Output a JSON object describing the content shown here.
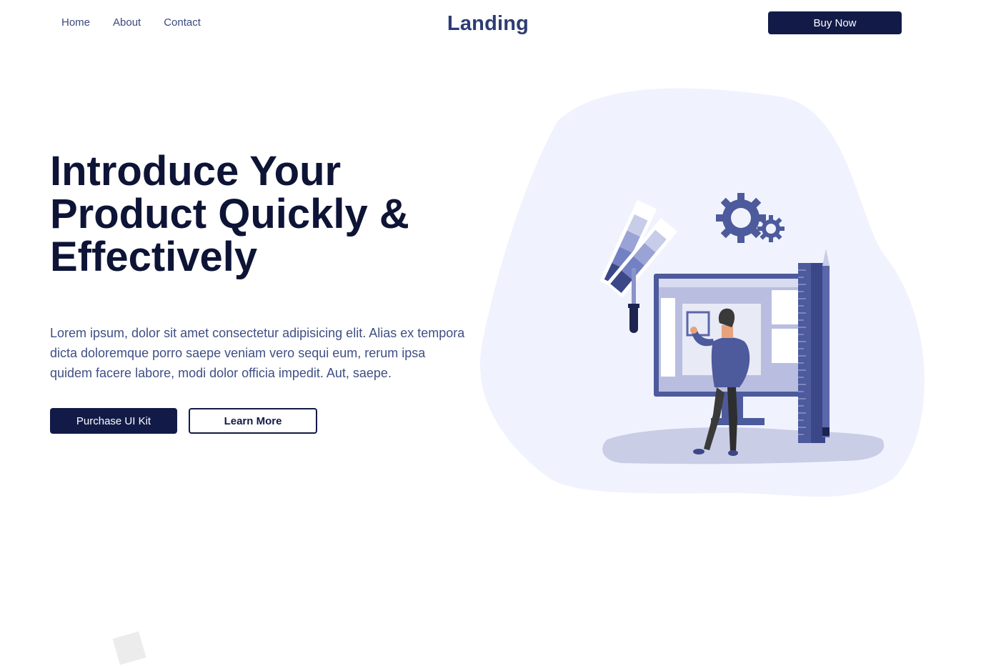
{
  "nav": {
    "links": [
      "Home",
      "About",
      "Contact"
    ],
    "brand": "Landing",
    "buy_label": "Buy Now"
  },
  "hero": {
    "title_lines": [
      "Introduce Your",
      "Product Quickly &",
      "Effectively"
    ],
    "description": "Lorem ipsum, dolor sit amet consectetur adipisicing elit. Alias ex tempora dicta doloremque porro saepe veniam vero sequi eum, rerum ipsa quidem facere labore, modi dolor officia impedit. Aut, saepe.",
    "primary_label": "Purchase UI Kit",
    "secondary_label": "Learn More"
  },
  "colors": {
    "primary": "#121b47",
    "accent": "#4f5ea3",
    "blob": "#f0f3fd"
  },
  "icons": [
    "gear-icon",
    "color-swatch-icon",
    "dropper-icon",
    "ruler-icon",
    "pencil-icon"
  ]
}
